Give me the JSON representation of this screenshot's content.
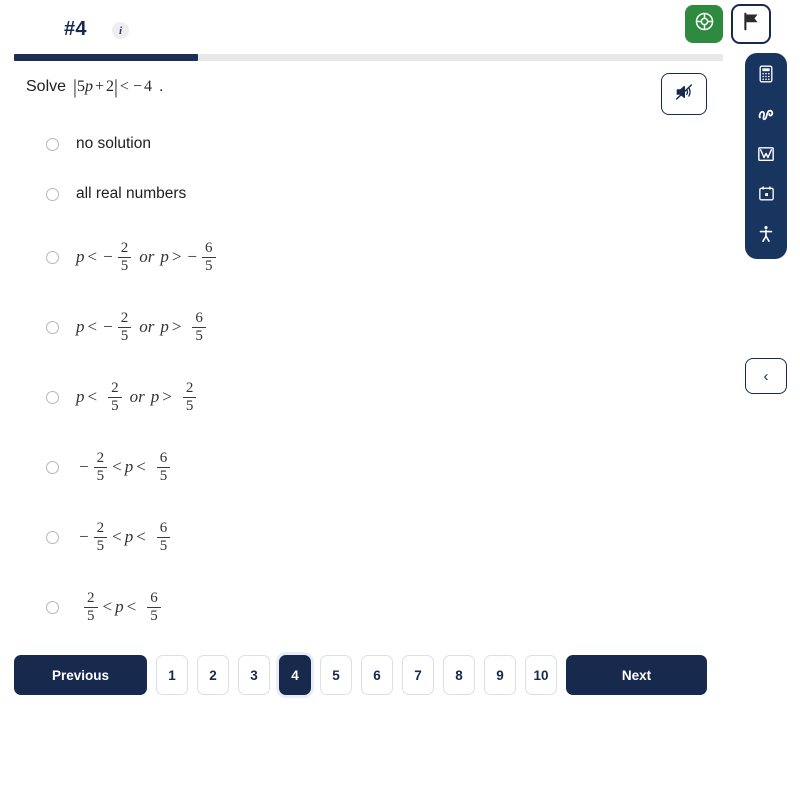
{
  "header": {
    "question_number": "#4",
    "info_icon": "info-icon",
    "help_icon": "lifebuoy-icon",
    "flag_icon": "flag-icon"
  },
  "progress": {
    "percent": 26
  },
  "question": {
    "prompt": "Solve",
    "expression_parts": {
      "bar_left": "|",
      "coefficient": "5",
      "variable": "p",
      "plus": "+",
      "constant": "2",
      "bar_right": "|",
      "relation": "<",
      "minus": "−",
      "rhs": "4",
      "period": "."
    },
    "audio_icon": "speaker-muted-icon"
  },
  "options": [
    {
      "id": "opt-1",
      "kind": "text",
      "label": "no solution",
      "selected": false
    },
    {
      "id": "opt-2",
      "kind": "text",
      "label": "all real numbers",
      "selected": false
    },
    {
      "id": "opt-3",
      "kind": "math",
      "selected": false,
      "left_var": "p",
      "left_rel": "<",
      "left_sign": "−",
      "left_num": "2",
      "left_den": "5",
      "conj": "or",
      "right_var": "p",
      "right_rel": ">",
      "right_sign": "−",
      "right_num": "6",
      "right_den": "5"
    },
    {
      "id": "opt-4",
      "kind": "math",
      "selected": false,
      "left_var": "p",
      "left_rel": "<",
      "left_sign": "−",
      "left_num": "2",
      "left_den": "5",
      "conj": "or",
      "right_var": "p",
      "right_rel": ">",
      "right_sign": "",
      "right_num": "6",
      "right_den": "5"
    },
    {
      "id": "opt-5",
      "kind": "math",
      "selected": false,
      "left_var": "p",
      "left_rel": "<",
      "left_sign": "",
      "left_num": "2",
      "left_den": "5",
      "conj": "or",
      "right_var": "p",
      "right_rel": ">",
      "right_sign": "",
      "right_num": "2",
      "right_den": "5"
    },
    {
      "id": "opt-6",
      "kind": "compound",
      "selected": false,
      "low_sign": "−",
      "low_num": "2",
      "low_den": "5",
      "rel_left": "<",
      "variable": "p",
      "rel_right": "<",
      "high_sign": "",
      "high_num": "6",
      "high_den": "5"
    },
    {
      "id": "opt-7",
      "kind": "compound",
      "selected": false,
      "low_sign": "−",
      "low_num": "2",
      "low_den": "5",
      "rel_left": "<",
      "variable": "p",
      "rel_right": "<",
      "high_sign": "",
      "high_num": "6",
      "high_den": "5"
    },
    {
      "id": "opt-8",
      "kind": "compound",
      "selected": false,
      "low_sign": "",
      "low_num": "2",
      "low_den": "5",
      "rel_left": "<",
      "variable": "p",
      "rel_right": "<",
      "high_sign": "",
      "high_num": "6",
      "high_den": "5"
    }
  ],
  "pagination": {
    "previous_label": "Previous",
    "next_label": "Next",
    "pages": [
      "1",
      "2",
      "3",
      "4",
      "5",
      "6",
      "7",
      "8",
      "9",
      "10"
    ],
    "current_page": "4"
  },
  "tool_rail": {
    "items": [
      {
        "icon": "calculator-icon",
        "name": "calculator-tool"
      },
      {
        "icon": "squiggle-draw-icon",
        "name": "scratchpad-tool"
      },
      {
        "icon": "graph-icon",
        "name": "graphing-tool"
      },
      {
        "icon": "notes-calendar-icon",
        "name": "notes-tool"
      },
      {
        "icon": "accessibility-icon",
        "name": "accessibility-tool"
      }
    ],
    "collapse_label": "‹"
  },
  "colors": {
    "navy": "#17294d",
    "rail_navy": "#17355e",
    "green": "#2d8a3e",
    "track_gray": "#e8e8e8",
    "border_gray": "#dcdfe4"
  }
}
